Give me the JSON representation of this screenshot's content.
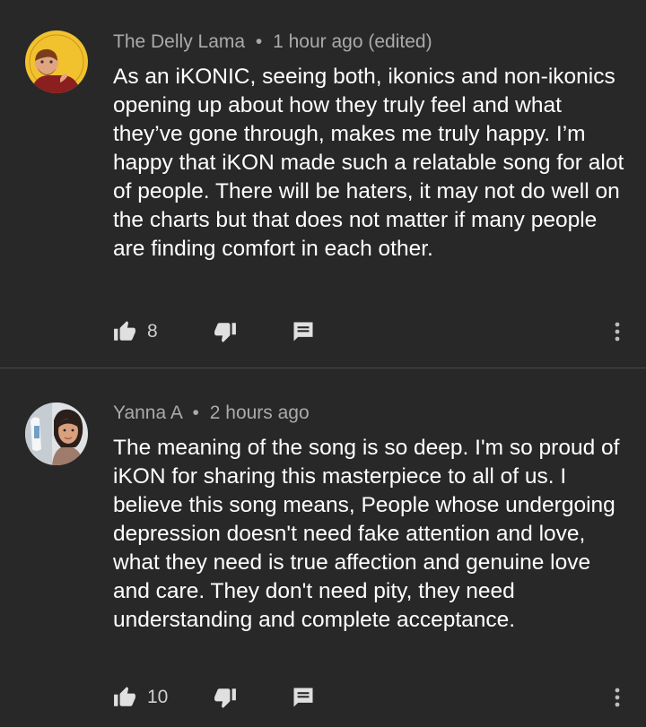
{
  "comments": [
    {
      "author": "The Delly Lama",
      "separator": "•",
      "time": "1 hour ago (edited)",
      "text": "As an iKONIC, seeing both, ikonics and non-ikonics opening up about how they truly feel and what they’ve gone through, makes me truly happy. I’m happy that iKON made such a relatable song for alot of people. There will be haters, it may not do well on the charts but that does not matter if many people are finding comfort in each other.",
      "likes": "8",
      "avatar_label": "THE DELLY LAMA"
    },
    {
      "author": "Yanna A",
      "separator": "•",
      "time": "2 hours ago",
      "text": "The meaning of the song is so deep. I'm so proud of iKON for sharing this masterpiece to all of us. I believe this song means, People whose undergoing depression doesn't need fake attention and love, what they need is true affection and genuine love and care. They don't need pity, they need understanding and complete acceptance.",
      "likes": "10"
    }
  ],
  "icons": {
    "like": "thumbs-up-icon",
    "dislike": "thumbs-down-icon",
    "reply": "reply-icon",
    "more": "more-vert-icon"
  },
  "colors": {
    "background": "#282828",
    "meta_text": "#aaaaaa",
    "body_text": "#ffffff",
    "icon": "#e0e0e0",
    "divider": "#4a4a4a",
    "avatar1_bg": "#f2c12e"
  }
}
